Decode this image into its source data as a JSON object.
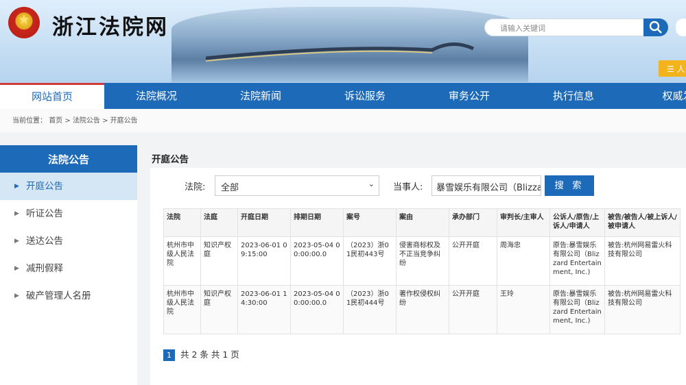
{
  "header": {
    "site_title": "浙江法院网",
    "search_placeholder": "请输入关键词",
    "user_button": "☰ 人"
  },
  "nav": {
    "items": [
      "网站首页",
      "法院概况",
      "法院新闻",
      "诉讼服务",
      "审务公开",
      "执行信息",
      "权威发"
    ]
  },
  "breadcrumb": {
    "prefix": "当前位置：",
    "path": "首页 > 法院公告 > 开庭公告"
  },
  "sidebar": {
    "title": "法院公告",
    "items": [
      "开庭公告",
      "听证公告",
      "送达公告",
      "减刑假释",
      "破产管理人名册"
    ]
  },
  "main": {
    "title": "开庭公告",
    "court_label": "法院:",
    "court_value": "全部",
    "party_label": "当事人:",
    "party_value": "暴雪娱乐有限公司（Blizzard",
    "search_button": "搜 索"
  },
  "table": {
    "headers": [
      "法院",
      "法庭",
      "开庭日期",
      "排期日期",
      "案号",
      "案由",
      "承办部门",
      "审判长/主审人",
      "公诉人/原告/上诉人/申请人",
      "被告/被告人/被上诉人/被申请人"
    ],
    "rows": [
      [
        "杭州市中级人民法院",
        "知识产权庭",
        "2023-06-01 09:15:00",
        "2023-05-04 00:00:00.0",
        "（2023）浙01民初443号",
        "侵害商标权及不正当竞争纠纷",
        "公开开庭",
        "周海忠",
        "原告:暴雪娱乐有限公司（Blizzard Entertainment, Inc.)",
        "被告:杭州网易雷火科技有限公司"
      ],
      [
        "杭州市中级人民法院",
        "知识产权庭",
        "2023-06-01 14:30:00",
        "2023-05-04 00:00:00.0",
        "（2023）浙01民初444号",
        "著作权侵权纠纷",
        "公开开庭",
        "王玲",
        "原告:暴雪娱乐有限公司（Blizzard Entertainment, Inc.)",
        "被告:杭州网易雷火科技有限公司"
      ]
    ]
  },
  "pager": {
    "current_page": "1",
    "summary": "共 2 条 共 1 页"
  }
}
